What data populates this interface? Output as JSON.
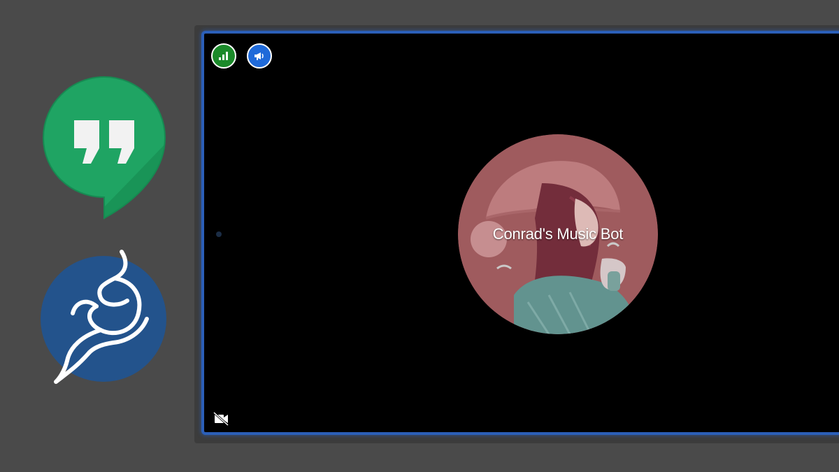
{
  "participant": {
    "display_name": "Conrad's Music Bot"
  },
  "indicators": {
    "connection_icon": "signal-bars-icon",
    "dominant_speaker_icon": "megaphone-icon",
    "video_muted_icon": "camera-off-icon"
  },
  "logos": {
    "left_top": "hangouts-logo-icon",
    "left_bottom": "jitsi-logo-icon"
  },
  "colors": {
    "background": "#4a4a4a",
    "tile_border": "#2b5fb8",
    "connection_good": "#1b8a2a",
    "speaker_indicator": "#1f6ad9",
    "hangouts_green": "#1fa463",
    "jitsi_blue": "#23538c"
  }
}
